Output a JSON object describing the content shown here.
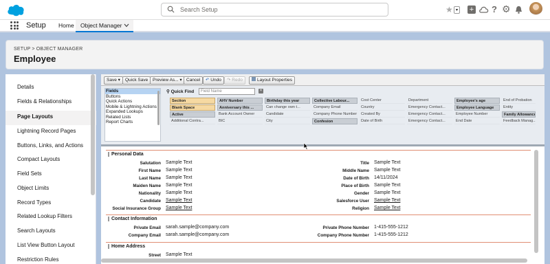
{
  "header": {
    "search_placeholder": "Search Setup",
    "colors": {
      "brand": "#0176d3",
      "orange": "#e08d72"
    }
  },
  "nav": {
    "app_name": "Setup",
    "home_tab": "Home",
    "object_manager_tab": "Object Manager"
  },
  "page": {
    "breadcrumb": "SETUP > OBJECT MANAGER",
    "title": "Employee"
  },
  "sidebar": {
    "items": [
      {
        "label": "Details"
      },
      {
        "label": "Fields & Relationships"
      },
      {
        "label": "Page Layouts"
      },
      {
        "label": "Lightning Record Pages"
      },
      {
        "label": "Buttons, Links, and Actions"
      },
      {
        "label": "Compact Layouts"
      },
      {
        "label": "Field Sets"
      },
      {
        "label": "Object Limits"
      },
      {
        "label": "Record Types"
      },
      {
        "label": "Related Lookup Filters"
      },
      {
        "label": "Search Layouts"
      },
      {
        "label": "List View Button Layout"
      },
      {
        "label": "Restriction Rules"
      }
    ]
  },
  "toolbar": {
    "save": "Save",
    "quick_save": "Quick Save",
    "preview_as": "Preview As...",
    "cancel": "Cancel",
    "undo": "Undo",
    "redo": "Redo",
    "layout_properties": "Layout Properties"
  },
  "palette": {
    "categories": [
      "Fields",
      "Buttons",
      "Quick Actions",
      "Mobile & Lightning Actions",
      "Expanded Lookups",
      "Related Lists",
      "Report Charts"
    ],
    "quick_find_label": "Quick Find",
    "quick_find_placeholder": "Field Name",
    "rows": [
      [
        "Section",
        "AHV Number",
        "Birthday this year",
        "Collective Labour...",
        "Cost Center",
        "Department",
        "Employee's age",
        "End of Probation"
      ],
      [
        "Blank Space",
        "Anniversary this ...",
        "Can change own t...",
        "Company Email",
        "Country",
        "Emergency Contact...",
        "Employee Language",
        "Entity"
      ],
      [
        "Active",
        "Bank Account Owner",
        "Candidate",
        "Company Phone Number",
        "Created By",
        "Emergency Contact...",
        "Employee Number",
        "Family Allowance"
      ],
      [
        "Additional Contra...",
        "BIC",
        "City",
        "Confesion",
        "Date of Birth",
        "Emergency Contact...",
        "End Date",
        "Feedback Manag..."
      ]
    ]
  },
  "form": {
    "personal_data": {
      "title": "Personal Data",
      "left": [
        [
          "Salutation",
          "Sample Text"
        ],
        [
          "First Name",
          "Sample Text"
        ],
        [
          "Last Name",
          "Sample Text"
        ],
        [
          "Maiden Name",
          "Sample Text"
        ],
        [
          "Nationality",
          "Sample Text"
        ],
        [
          "Candidate",
          "Sample Text"
        ],
        [
          "Social Insurance Group",
          "Sample Text"
        ]
      ],
      "right": [
        [
          "Title",
          "Sample Text"
        ],
        [
          "Middle Name",
          "Sample Text"
        ],
        [
          "Date of Birth",
          "14/11/2024"
        ],
        [
          "Place of Birth",
          "Sample Text"
        ],
        [
          "Gender",
          "Sample Text"
        ],
        [
          "Salesforce User",
          "Sample Text"
        ],
        [
          "Religion",
          "Sample Text"
        ]
      ]
    },
    "contact": {
      "title": "Contact Information",
      "left": [
        [
          "Private Email",
          "sarah.sample@company.com"
        ],
        [
          "Company Email",
          "sarah.sample@company.com"
        ]
      ],
      "right": [
        [
          "Private Phone Number",
          "1-415-555-1212"
        ],
        [
          "Company Phone Number",
          "1-415-555-1212"
        ]
      ]
    },
    "home_address": {
      "title": "Home Address",
      "left": [
        [
          "Street",
          "Sample Text"
        ]
      ]
    }
  }
}
